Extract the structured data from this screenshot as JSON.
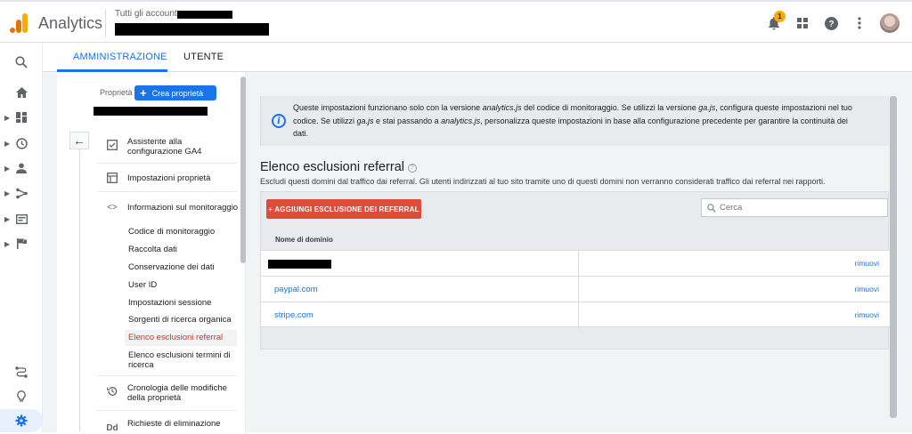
{
  "header": {
    "app_title": "Analytics",
    "account_label": "Tutti gli account",
    "notification_count": "1",
    "icons": [
      "bell-icon",
      "apps-grid-icon",
      "help-icon",
      "more-vert-icon",
      "avatar"
    ]
  },
  "tabs": [
    {
      "label": "AMMINISTRAZIONE",
      "active": true
    },
    {
      "label": "UTENTE",
      "active": false
    }
  ],
  "left_nav": [
    "search-icon",
    "home-icon",
    "dashboard-icon",
    "clock-icon",
    "person-icon",
    "fork-icon",
    "display-icon",
    "flag-icon",
    "route-icon",
    "lightbulb-icon",
    "gear-icon"
  ],
  "property_panel": {
    "label": "Proprietà",
    "create_button": "Crea proprietà",
    "items": [
      {
        "icon": "checkbox-icon",
        "label": "Assistente alla configurazione GA4"
      },
      {
        "icon": "layout-icon",
        "label": "Impostazioni proprietà"
      },
      {
        "icon": "code-icon",
        "label": "Informazioni sul monitoraggio"
      }
    ],
    "sub_items": [
      "Codice di monitoraggio",
      "Raccolta dati",
      "Conservazione dei dati",
      "User ID",
      "Impostazioni sessione",
      "Sorgenti di ricerca organica",
      "Elenco esclusioni referral",
      "Elenco esclusioni termini di ricerca"
    ],
    "active_sub_item": "Elenco esclusioni referral",
    "bottom_items": [
      {
        "icon": "history-icon",
        "label": "Cronologia delle modifiche della proprietà"
      },
      {
        "icon": "dd-icon",
        "label": "Richieste di eliminazione"
      }
    ]
  },
  "info": {
    "line1_a": "Queste impostazioni funzionano solo con la versione ",
    "line1_b": "analytics.js",
    "line1_c": " del codice di monitoraggio. Se utilizzi la versione ",
    "line1_d": "ga.js",
    "line1_e": ", configura queste impostazioni nel tuo",
    "line2_a": "codice. Se utilizzi ",
    "line2_b": "ga.js",
    "line2_c": " e stai passando a ",
    "line2_d": "analytics.js",
    "line2_e": ", personalizza queste impostazioni in base alla configurazione precedente per garantire la continuità dei",
    "line3": "dati."
  },
  "section": {
    "title": "Elenco esclusioni referral",
    "description": "Escludi questi domini dal traffico dai referral. Gli utenti indirizzati al tuo sito tramite uno di questi domini non verranno considerati traffico dai referral nei rapporti.",
    "add_button": "+ AGGIUNGI ESCLUSIONE DEI REFERRAL",
    "search_placeholder": "Cerca",
    "column_header": "Nome di dominio",
    "rows": [
      {
        "domain": "",
        "action": "rimuovi"
      },
      {
        "domain": "paypal.com",
        "action": "rimuovi"
      },
      {
        "domain": "stripe.com",
        "action": "rimuovi"
      }
    ]
  }
}
